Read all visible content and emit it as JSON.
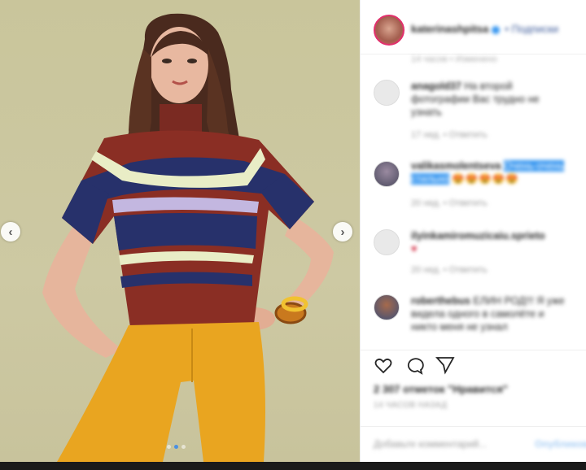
{
  "post": {
    "nav_prev": "‹",
    "nav_next": "›",
    "carousel_dots": 3,
    "carousel_active_index": 1
  },
  "header": {
    "username": "katerinashpitsa",
    "follow_label": "• Подписки",
    "more": "•",
    "time": "14 часов • Изменено"
  },
  "comments": [
    {
      "username": "anagold37",
      "text": "На второй фотографии Вас трудно не узнать",
      "meta": "17 нед. • Ответить",
      "avatar": "default"
    },
    {
      "username": "valikasmolentseva",
      "text": "Очень-очень стильно",
      "emojis": "😍😍😍😍😍",
      "meta": "20 нед. • Ответить",
      "avatar": "photo"
    },
    {
      "username": "ilyinkamiromuzicaiu.sprieto",
      "text": "♥",
      "meta": "20 нед. • Ответить",
      "avatar": "default"
    },
    {
      "username": "roberthebus",
      "text": "ЕЛИН РОД!!! Я уже видела одного в самолёте и никто меня не узнал",
      "meta": "",
      "avatar": "photo"
    }
  ],
  "actions": {
    "likes": "2 307 отметок \"Нравится\"",
    "date": "14 ЧАСОВ НАЗАД"
  },
  "comment_box": {
    "placeholder": "Добавьте комментарий...",
    "publish": "Опубликовать"
  },
  "colors": {
    "accent": "#3897f0",
    "background_photo": "#c9c59b",
    "sweater_red": "#8a2e24",
    "sweater_navy": "#27316b",
    "pants_yellow": "#e9a520"
  }
}
